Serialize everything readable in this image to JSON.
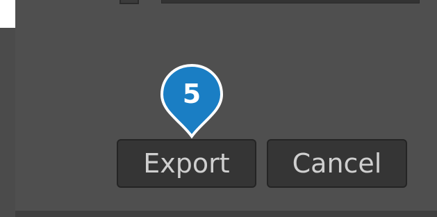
{
  "dialog": {
    "buttons": {
      "export_label": "Export",
      "cancel_label": "Cancel"
    }
  },
  "annotation": {
    "step_number": "5",
    "color": "#1a7ec4"
  },
  "colors": {
    "dialog_bg": "#4f4f4f",
    "button_bg": "#353535",
    "button_text": "#cfcfcf"
  }
}
